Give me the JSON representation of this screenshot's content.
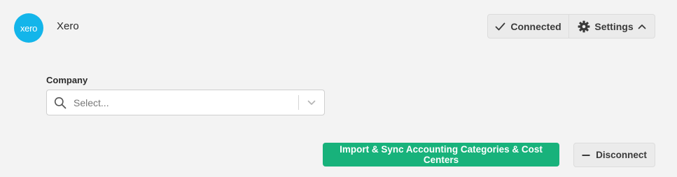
{
  "integration": {
    "logo_text": "xero",
    "name": "Xero",
    "brand_color": "#13b5ea"
  },
  "status": {
    "connected_label": "Connected",
    "connected_icon": "check-icon",
    "settings_label": "Settings",
    "settings_icon": "gear-icon",
    "settings_chevron": "chevron-up-icon"
  },
  "company": {
    "label": "Company",
    "placeholder": "Select...",
    "value": "",
    "search_icon": "search-icon",
    "dropdown_icon": "chevron-down-icon"
  },
  "actions": {
    "import_label": "Import & Sync Accounting Categories & Cost Centers",
    "import_color": "#18b27b",
    "disconnect_label": "Disconnect",
    "disconnect_icon": "minus-icon"
  }
}
